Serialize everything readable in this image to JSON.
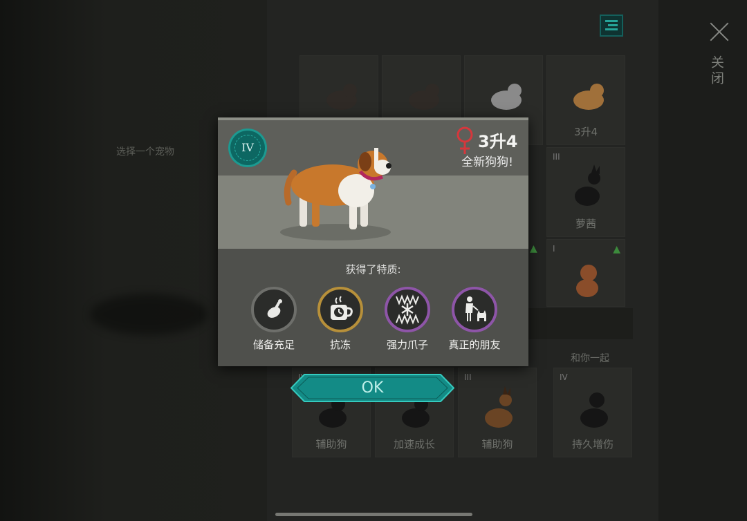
{
  "header": {
    "select_hint": "选择一个宠物",
    "close_label": "关闭"
  },
  "pet_grid": [
    {
      "tier": "",
      "name": "",
      "color": "#2f2a26"
    },
    {
      "tier": "",
      "name": "",
      "color": "#2f2a26"
    },
    {
      "tier": "",
      "name": "",
      "color": "#8a8a8a"
    },
    {
      "tier": "",
      "name": "3升4",
      "color": "#a0703a"
    },
    {
      "tier": "III",
      "name": "萝茜",
      "color": "#151515"
    },
    {
      "tier": "I",
      "name": "",
      "color": "#8a4d2a"
    },
    {
      "tier": "IV",
      "name": "辅助狗",
      "color": "#151515"
    },
    {
      "tier": "",
      "name": "加速成长",
      "color": "#151515"
    },
    {
      "tier": "III",
      "name": "辅助狗",
      "color": "#6a4424"
    },
    {
      "tier": "IV",
      "name": "持久增伤",
      "color": "#151515"
    }
  ],
  "together_label": "和你一起",
  "modal": {
    "tier": "IV",
    "age": "3升4",
    "gender_icon": "female-icon",
    "new_dog_label": "全新狗狗!",
    "traits_title": "获得了特质:",
    "traits": [
      {
        "label": "储备充足",
        "icon": "meat-icon",
        "ring_color": "#6e6f6b"
      },
      {
        "label": "抗冻",
        "icon": "hot-drink-icon",
        "ring_color": "#b7903a"
      },
      {
        "label": "强力爪子",
        "icon": "snowflake-claw-icon",
        "ring_color": "#8e55a8"
      },
      {
        "label": "真正的朋友",
        "icon": "person-dog-icon",
        "ring_color": "#8e55a8"
      }
    ],
    "ok_label": "OK"
  },
  "colors": {
    "accent": "#1aa89c",
    "ok_fill": "#138b86",
    "female": "#d6373c"
  }
}
